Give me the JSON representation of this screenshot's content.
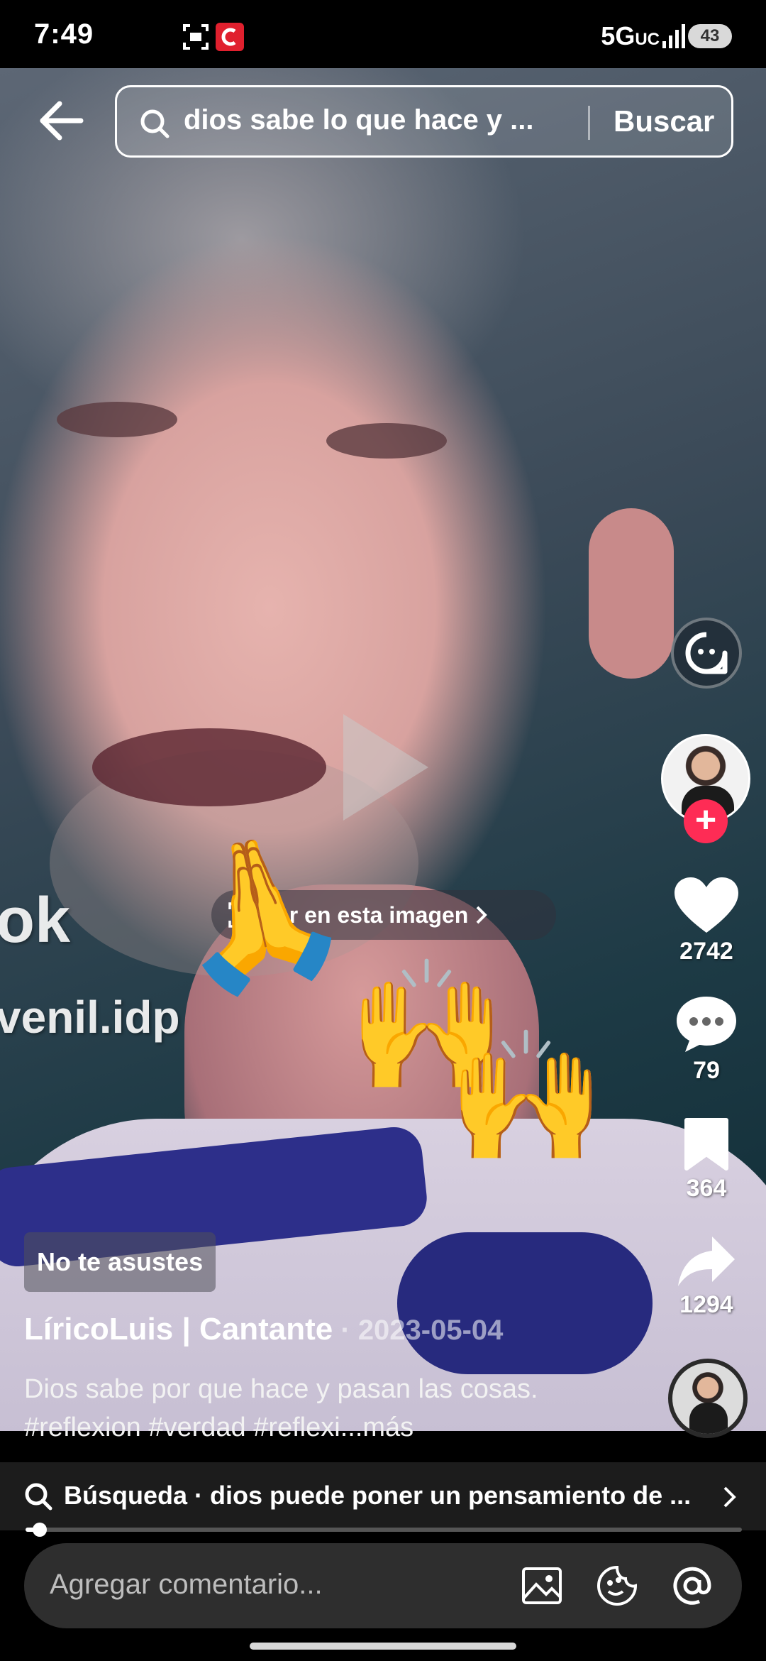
{
  "status_bar": {
    "time": "7:49",
    "network": "5G",
    "network_sub": "UC",
    "battery": "43"
  },
  "search": {
    "query": "dios sabe lo que hace y ...",
    "button": "Buscar"
  },
  "video": {
    "overlay_text_1": "ok",
    "overlay_text_2": "venil.idp",
    "scan_pill_text": "ar en esta imagen",
    "emojis": {
      "pray": "🙏",
      "raise": "🙌"
    }
  },
  "actions": {
    "likes": "2742",
    "comments": "79",
    "saves": "364",
    "shares": "1294"
  },
  "post": {
    "tag": "No te asustes",
    "author": "LíricoLuis | Cantante",
    "date": " · 2023-05-04",
    "caption": "Dios sabe por que hace y pasan las cosas. #reflexion #verdad #reflexi...más"
  },
  "related_search": {
    "text": "Búsqueda · dios puede poner un pensamiento de ..."
  },
  "playback": {
    "progress": 0.02
  },
  "comment_bar": {
    "placeholder": "Agregar comentario..."
  },
  "colors": {
    "follow": "#fe2c55",
    "bar_bg": "#2e2e2e"
  }
}
